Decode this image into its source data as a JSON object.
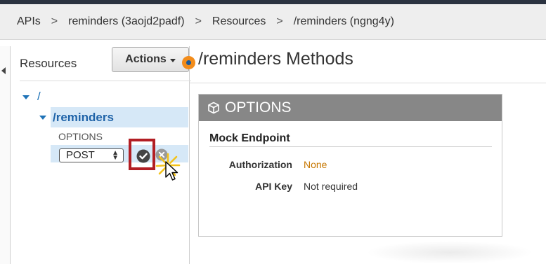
{
  "breadcrumb": {
    "items": [
      "APIs",
      "reminders (3aojd2padf)",
      "Resources",
      "/reminders (ngng4y)"
    ],
    "separator": ">"
  },
  "resources_panel": {
    "title": "Resources",
    "actions_label": "Actions",
    "tree": {
      "root": "/",
      "selected_resource": "/reminders",
      "existing_method": "OPTIONS",
      "new_method_select": {
        "selected": "POST"
      }
    }
  },
  "main": {
    "title": "/reminders Methods",
    "method_card": {
      "method": "OPTIONS",
      "integration": "Mock Endpoint",
      "rows": [
        {
          "label": "Authorization",
          "value": "None"
        },
        {
          "label": "API Key",
          "value": "Not required"
        }
      ]
    }
  },
  "icons": {
    "collapse": "chevron-left-icon",
    "tree_expand": "caret-down-icon",
    "confirm": "check-circle-icon",
    "cancel": "x-circle-icon",
    "cube": "cube-icon",
    "status_dot": "dot-icon",
    "cursor": "mouse-pointer-icon",
    "highlight": "click-highlight-icon"
  },
  "colors": {
    "link_blue": "#1f73b7",
    "selection_bg": "#d6e8f7",
    "card_header": "#878787",
    "authorization_value": "#c77700",
    "highlight_border": "#b21e24",
    "status_dot": "#f28c1b"
  }
}
